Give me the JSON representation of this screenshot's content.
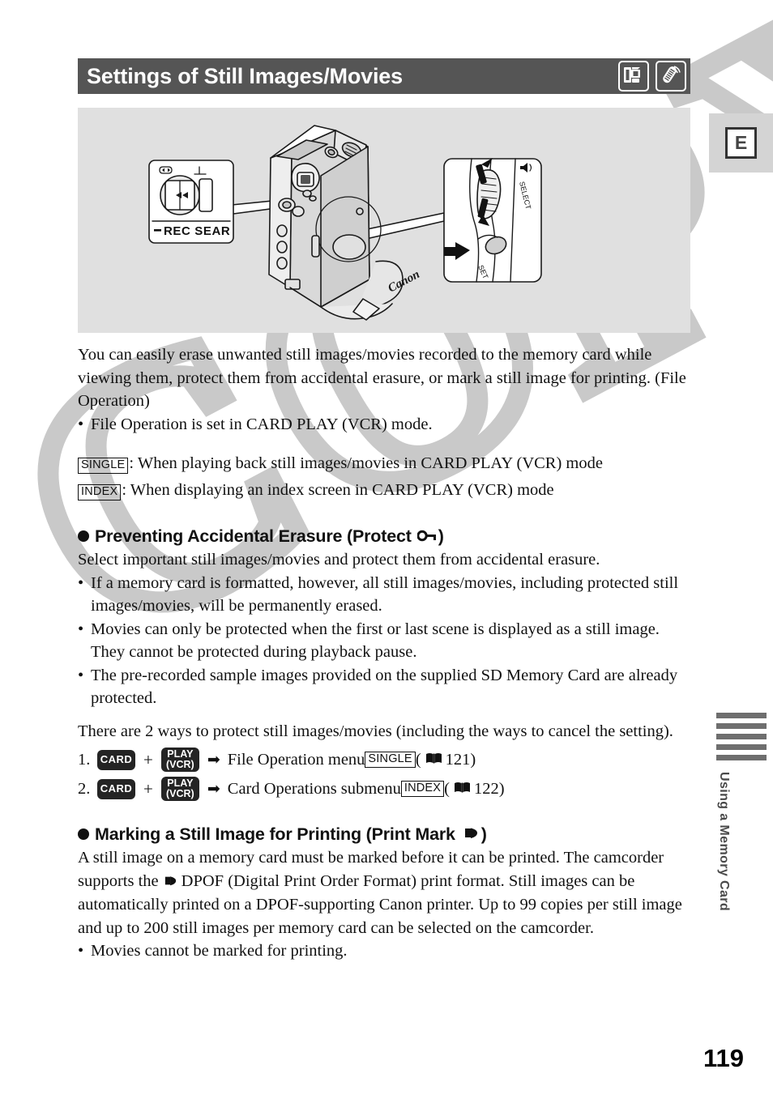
{
  "header": {
    "title": "Settings of Still Images/Movies",
    "icons": [
      {
        "name": "camcorder-icon",
        "label": "camcorder"
      },
      {
        "name": "remote-control-icon",
        "label": "remote control"
      }
    ]
  },
  "right_tab": {
    "letter": "E"
  },
  "sidebar": {
    "label": "Using a Memory Card",
    "bar_count": 5,
    "bar_color": "#6e6e6e"
  },
  "illustration": {
    "callout_left_label": "REC SEAR",
    "callout_right_labels": [
      "SELECT",
      "SET"
    ],
    "brand": "Canon",
    "panel_bg": "#e0e0e0"
  },
  "watermark": {
    "text": "COPY",
    "color": "#c9c9c9"
  },
  "intro": {
    "paragraph": "You can easily erase unwanted still images/movies recorded to the memory card while viewing them, protect them from accidental erasure, or mark a still image for printing. (File Operation)",
    "bullet": "File Operation is set in CARD PLAY (VCR) mode."
  },
  "modes": [
    {
      "box": "SINGLE",
      "text": ": When playing back still images/movies in CARD PLAY (VCR) mode"
    },
    {
      "box": "INDEX",
      "text": ": When displaying an index screen in CARD PLAY (VCR) mode"
    }
  ],
  "protect_section": {
    "heading_pre": "Preventing Accidental Erasure (Protect",
    "heading_post": ")",
    "heading_icon": "key-icon",
    "intro": "Select important still images/movies and protect them from accidental erasure.",
    "bullets": [
      "If a memory card is formatted, however, all still images/movies, including protected still images/movies, will be permanently erased.",
      "Movies can only be protected when the first or last scene is displayed as a still image. They cannot be protected during playback pause.",
      "The pre-recorded sample images provided on the supplied SD Memory Card are already protected."
    ],
    "ways_paragraph": "There are 2 ways to protect still images/movies (including the ways to cancel the setting).",
    "steps": [
      {
        "num": "1.",
        "badge_card": "CARD",
        "badge_play_line1": "PLAY",
        "badge_play_line2": "(VCR)",
        "plus": "+",
        "arrow": "➡",
        "text": "File Operation menu",
        "mode_box": "SINGLE",
        "ref_open": "(",
        "ref_page": "121",
        "ref_close": ")"
      },
      {
        "num": "2.",
        "badge_card": "CARD",
        "badge_play_line1": "PLAY",
        "badge_play_line2": "(VCR)",
        "plus": "+",
        "arrow": "➡",
        "text": "Card Operations submenu",
        "mode_box": "INDEX",
        "ref_open": "(",
        "ref_page": "122",
        "ref_close": ")"
      }
    ]
  },
  "print_section": {
    "heading_pre": "Marking a Still Image for Printing (Print Mark",
    "heading_post": ")",
    "heading_icon": "print-mark-icon",
    "body_1": "A still image on a memory card must be marked before it can be printed. The camcorder supports the",
    "body_2": "DPOF (Digital Print Order Format) print format. Still images can be automatically printed on a DPOF-supporting Canon printer. Up to 99 copies per still image and up to 200 still images per memory card can be selected on the camcorder.",
    "bullet": "Movies cannot be marked for printing."
  },
  "page_number": "119"
}
